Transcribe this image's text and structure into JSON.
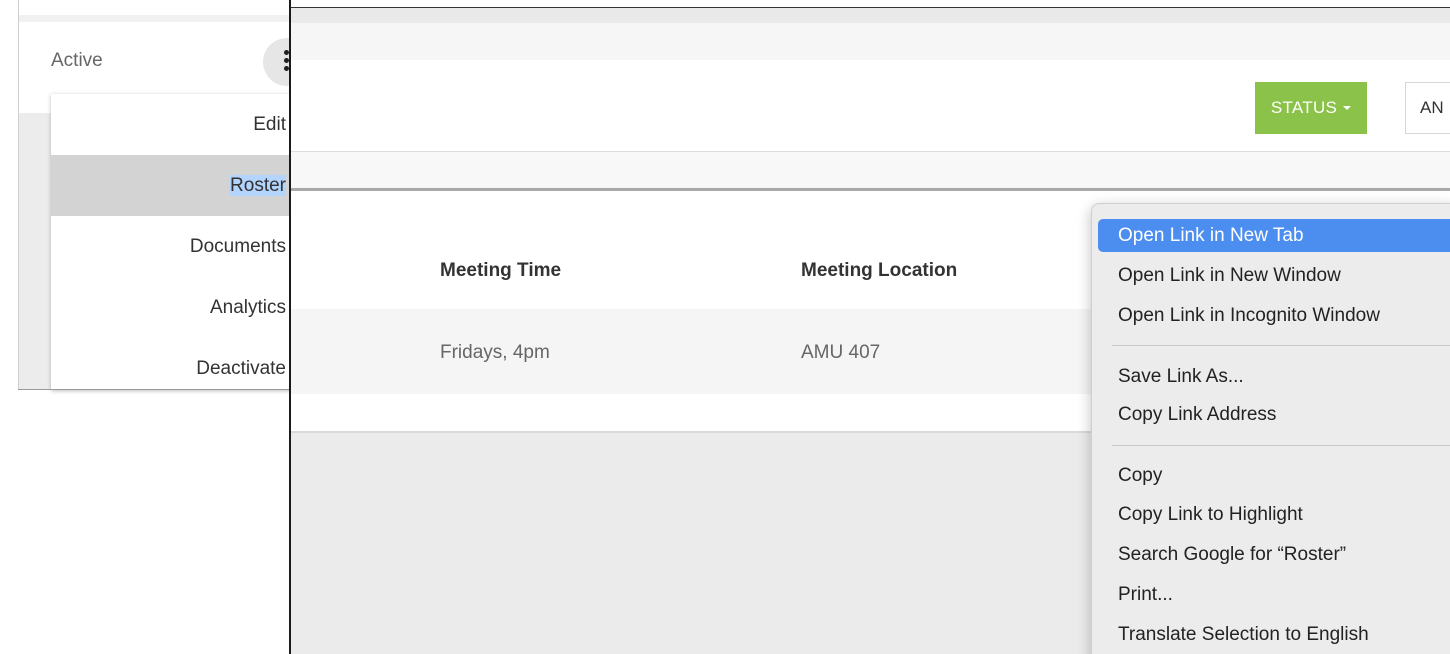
{
  "left_panel": {
    "status_label": "Active",
    "action_menu": {
      "items": [
        {
          "label": "Edit"
        },
        {
          "label": "Roster"
        },
        {
          "label": "Documents"
        },
        {
          "label": "Analytics"
        },
        {
          "label": "Deactivate"
        }
      ],
      "active_index": 1
    }
  },
  "toolbar": {
    "status_button_label": "STATUS",
    "second_button_label": "AN"
  },
  "table": {
    "columns": [
      "Meeting Time",
      "Meeting Location"
    ],
    "rows": [
      {
        "meeting_time": "Fridays, 4pm",
        "meeting_location": "AMU 407"
      }
    ]
  },
  "context_menu": {
    "items": [
      {
        "label": "Open Link in New Tab",
        "highlighted": true
      },
      {
        "label": "Open Link in New Window"
      },
      {
        "label": "Open Link in Incognito Window"
      },
      {
        "label": "Save Link As..."
      },
      {
        "label": "Copy Link Address"
      },
      {
        "label": "Copy"
      },
      {
        "label": "Copy Link to Highlight"
      },
      {
        "label": "Search Google for “Roster”"
      },
      {
        "label": "Print..."
      },
      {
        "label": "Translate Selection to English"
      }
    ]
  },
  "colors": {
    "status_button": "#8bc34a",
    "menu_highlight": "#4c8df0",
    "selection": "#b3d4fc",
    "fab": "#17365d"
  }
}
